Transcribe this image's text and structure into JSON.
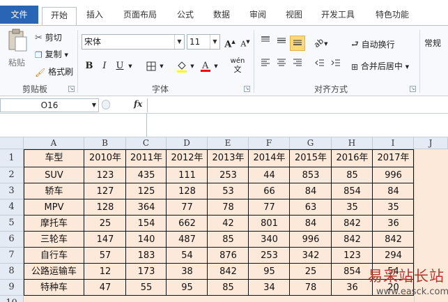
{
  "tabs": [
    "文件",
    "开始",
    "插入",
    "页面布局",
    "公式",
    "数据",
    "审阅",
    "视图",
    "开发工具",
    "特色功能"
  ],
  "ribbon": {
    "clipboard": {
      "label": "剪贴板",
      "paste": "粘贴",
      "cut": "剪切",
      "copy": "复制",
      "format_painter": "格式刷"
    },
    "font": {
      "label": "字体",
      "font_name": "宋体",
      "font_size": "11",
      "bold": "B",
      "italic": "I",
      "underline": "U",
      "grow": "A",
      "shrink": "A",
      "phonetic": "wén"
    },
    "alignment": {
      "label": "对齐方式",
      "wrap_text": "自动换行",
      "merge_center": "合并后居中"
    },
    "number": {
      "format": "常规"
    }
  },
  "formula_bar": {
    "name_box": "O16",
    "fx": "fx",
    "value": ""
  },
  "sheet": {
    "columns": [
      "A",
      "B",
      "C",
      "D",
      "E",
      "F",
      "G",
      "H",
      "I",
      "J"
    ],
    "rows": [
      "1",
      "2",
      "3",
      "4",
      "5",
      "6",
      "7",
      "8",
      "9",
      "10"
    ],
    "table": [
      [
        "车型",
        "2010年",
        "2011年",
        "2012年",
        "2013年",
        "2014年",
        "2015年",
        "2016年",
        "2017年"
      ],
      [
        "SUV",
        "123",
        "435",
        "111",
        "253",
        "44",
        "853",
        "85",
        "996"
      ],
      [
        "轿车",
        "127",
        "125",
        "128",
        "53",
        "66",
        "84",
        "854",
        "84"
      ],
      [
        "MPV",
        "128",
        "364",
        "77",
        "78",
        "77",
        "63",
        "35",
        "35"
      ],
      [
        "摩托车",
        "25",
        "154",
        "662",
        "42",
        "801",
        "84",
        "842",
        "36"
      ],
      [
        "三轮车",
        "147",
        "140",
        "487",
        "85",
        "340",
        "996",
        "842",
        "842"
      ],
      [
        "自行车",
        "57",
        "183",
        "54",
        "876",
        "253",
        "342",
        "123",
        "294"
      ],
      [
        "公路运输车",
        "12",
        "173",
        "38",
        "842",
        "95",
        "25",
        "854",
        "54"
      ],
      [
        "特种车",
        "47",
        "55",
        "95",
        "85",
        "34",
        "78",
        "36",
        "20"
      ]
    ],
    "fill_color": "#fde9d9"
  },
  "watermark": {
    "title": "易采站长站",
    "url": "www.easck.com"
  }
}
